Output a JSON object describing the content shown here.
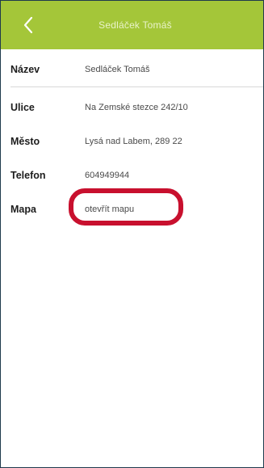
{
  "header": {
    "title": "Sedláček Tomáš",
    "back_icon": "chevron-left-icon",
    "background": "#a4c639"
  },
  "details": [
    {
      "key": "nazev",
      "label": "Název",
      "value": "Sedláček Tomáš"
    },
    {
      "key": "ulice",
      "label": "Ulice",
      "value": "Na Zemské stezce 242/10"
    },
    {
      "key": "mesto",
      "label": "Město",
      "value": "Lysá nad Labem, 289 22"
    },
    {
      "key": "telefon",
      "label": "Telefon",
      "value": "604949944"
    },
    {
      "key": "mapa",
      "label": "Mapa",
      "value": "otevřít mapu"
    }
  ],
  "annotation": {
    "highlight_color": "#c8102e"
  }
}
